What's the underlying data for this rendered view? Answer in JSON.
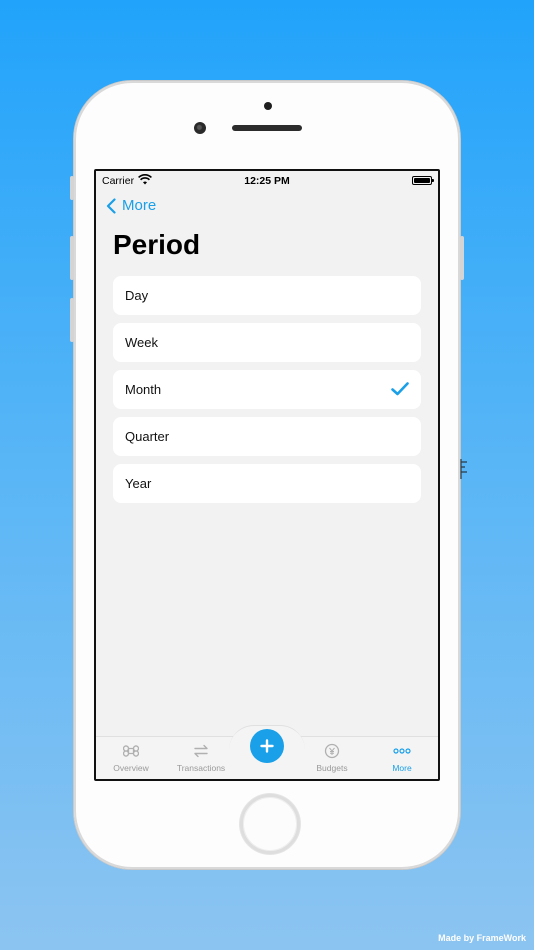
{
  "status_bar": {
    "carrier": "Carrier",
    "time": "12:25 PM"
  },
  "nav": {
    "back_label": "More"
  },
  "page": {
    "title": "Period"
  },
  "options": [
    {
      "label": "Day",
      "selected": false
    },
    {
      "label": "Week",
      "selected": false
    },
    {
      "label": "Month",
      "selected": true
    },
    {
      "label": "Quarter",
      "selected": false
    },
    {
      "label": "Year",
      "selected": false
    }
  ],
  "tab_bar": {
    "tabs": [
      {
        "label": "Overview",
        "icon": "command-icon",
        "active": false
      },
      {
        "label": "Transactions",
        "icon": "swap-arrows-icon",
        "active": false
      },
      {
        "label": "Budgets",
        "icon": "coin-icon",
        "active": false
      },
      {
        "label": "More",
        "icon": "dots-icon",
        "active": true
      }
    ],
    "add_icon": "plus-icon"
  },
  "colors": {
    "accent": "#1aa0e8",
    "background_top": "#21a3fb",
    "background_bottom": "#8cc4f1",
    "screen_bg": "#f2f2f2"
  },
  "footer": {
    "credit": "Made by FrameWork"
  }
}
